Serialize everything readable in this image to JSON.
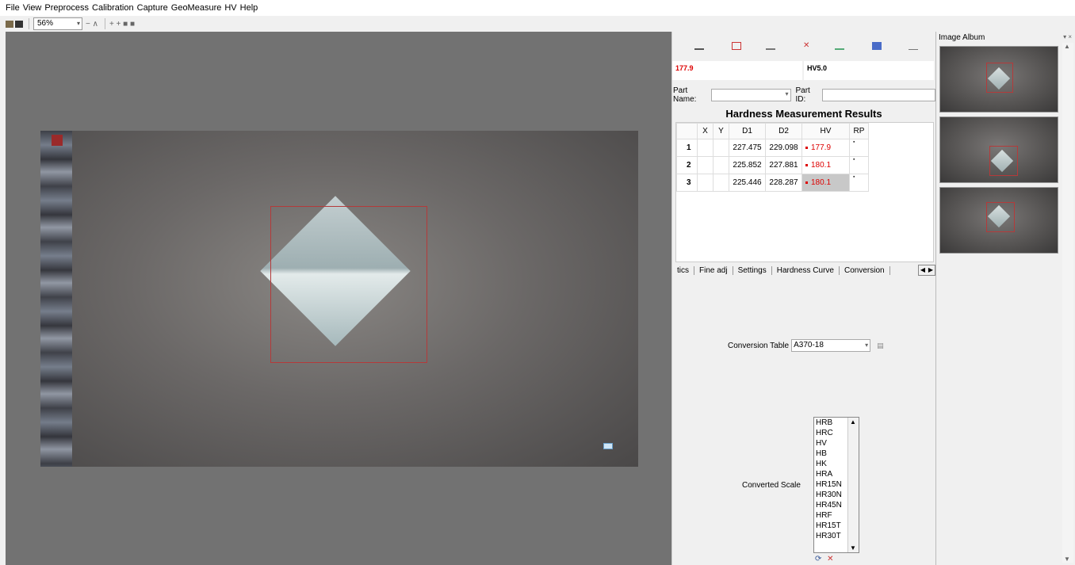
{
  "menu": [
    "File",
    "View",
    "Preprocess",
    "Calibration",
    "Capture",
    "GeoMeasure",
    "HV",
    "Help"
  ],
  "toolbar": {
    "zoom_value": "56%",
    "glyphs_a": "− ∧",
    "glyphs_b": "+ + ■ ■"
  },
  "readout": {
    "hv_value": "177.9",
    "scale": "HV5.0"
  },
  "part": {
    "name_label": "Part Name:",
    "id_label": "Part ID:"
  },
  "results": {
    "title": "Hardness Measurement Results",
    "columns": [
      "X",
      "Y",
      "D1",
      "D2",
      "HV",
      "RP"
    ],
    "rows": [
      {
        "n": "1",
        "d1": "227.475",
        "d2": "229.098",
        "hv": "177.9"
      },
      {
        "n": "2",
        "d1": "225.852",
        "d2": "227.881",
        "hv": "180.1"
      },
      {
        "n": "3",
        "d1": "225.446",
        "d2": "228.287",
        "hv": "180.1"
      }
    ]
  },
  "tabs": [
    "tics",
    "Fine adj",
    "Settings",
    "Hardness Curve",
    "Conversion"
  ],
  "conversion": {
    "table_label": "Conversion Table",
    "table_value": "A370-18",
    "scale_label": "Converted Scale",
    "scales": [
      "HRB",
      "HRC",
      "HV",
      "HB",
      "HK",
      "HRA",
      "HR15N",
      "HR30N",
      "HR45N",
      "HRF",
      "HR15T",
      "HR30T"
    ]
  },
  "album": {
    "title": "Image Album"
  },
  "colors": {
    "hv_red": "#dd0000",
    "box_red": "#b43a3a",
    "view_gray": "#727272"
  }
}
